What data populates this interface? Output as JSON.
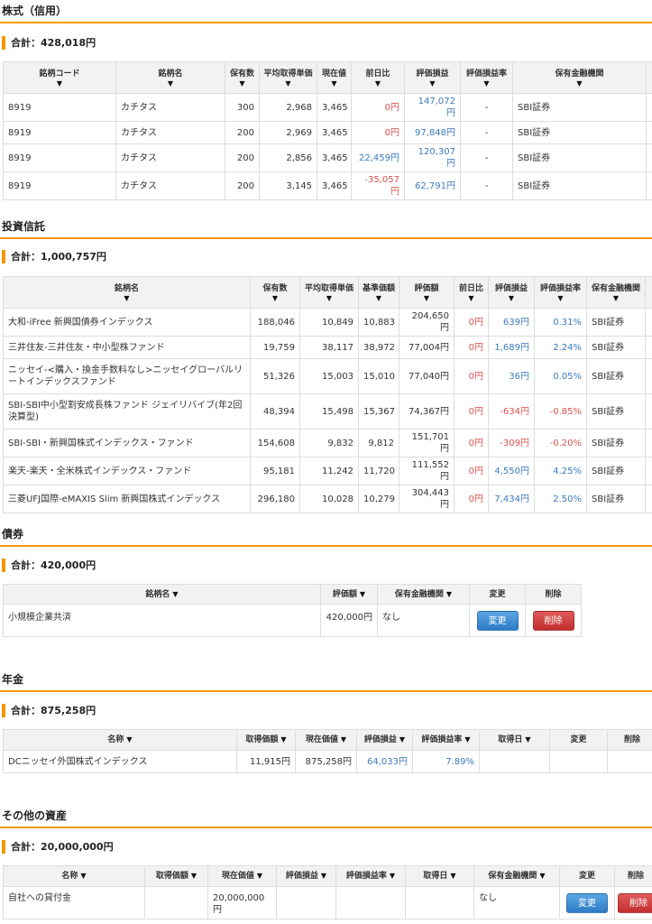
{
  "stocks": {
    "title": "株式（信用）",
    "total": "合計：428,018円",
    "headers": [
      "銘柄コード",
      "銘柄名",
      "保有数",
      "平均取得単価",
      "現在値",
      "前日比",
      "評価損益",
      "評価損益率",
      "保有金融機関"
    ],
    "rows": [
      [
        "8919",
        "カチタス",
        "300",
        "2,968",
        "3,465",
        "0円",
        "147,072円",
        "-",
        "SBI証券"
      ],
      [
        "8919",
        "カチタス",
        "200",
        "2,969",
        "3,465",
        "0円",
        "97,848円",
        "-",
        "SBI証券"
      ],
      [
        "8919",
        "カチタス",
        "200",
        "2,856",
        "3,465",
        "22,459円",
        "120,307円",
        "-",
        "SBI証券"
      ],
      [
        "8919",
        "カチタス",
        "200",
        "3,145",
        "3,465",
        "-35,057円",
        "62,791円",
        "-",
        "SBI証券"
      ]
    ]
  },
  "funds": {
    "title": "投資信託",
    "total": "合計：1,000,757円",
    "headers": [
      "銘柄名",
      "保有数",
      "平均取得単価",
      "基準価額",
      "評価額",
      "前日比",
      "評価損益",
      "評価損益率",
      "保有金融機関"
    ],
    "rows": [
      [
        "大和-iFree 新興国債券インデックス",
        "188,046",
        "10,849",
        "10,883",
        "204,650円",
        "0円",
        "639円",
        "0.31%",
        "SBI証券"
      ],
      [
        "三井住友-三井住友・中小型株ファンド",
        "19,759",
        "38,117",
        "38,972",
        "77,004円",
        "0円",
        "1,689円",
        "2.24%",
        "SBI証券"
      ],
      [
        "ニッセイ-<購入・換金手数料なし>ニッセイグローバルリートインデックスファンド",
        "51,326",
        "15,003",
        "15,010",
        "77,040円",
        "0円",
        "36円",
        "0.05%",
        "SBI証券"
      ],
      [
        "SBI-SBI中小型割安成長株ファンド ジェイリバイブ(年2回決算型)",
        "48,394",
        "15,498",
        "15,367",
        "74,367円",
        "0円",
        "-634円",
        "-0.85%",
        "SBI証券"
      ],
      [
        "SBI-SBI・新興国株式インデックス・ファンド",
        "154,608",
        "9,832",
        "9,812",
        "151,701円",
        "0円",
        "-309円",
        "-0.20%",
        "SBI証券"
      ],
      [
        "楽天-楽天・全米株式インデックス・ファンド",
        "95,181",
        "11,242",
        "11,720",
        "111,552円",
        "0円",
        "4,550円",
        "4.25%",
        "SBI証券"
      ],
      [
        "三菱UFJ国際-eMAXIS Slim 新興国株式インデックス",
        "296,180",
        "10,028",
        "10,279",
        "304,443円",
        "0円",
        "7,434円",
        "2.50%",
        "SBI証券"
      ]
    ]
  },
  "bonds": {
    "title": "債券",
    "total": "合計：420,000円",
    "headers": [
      "銘柄名",
      "評価額",
      "保有金融機関",
      "変更",
      "削除"
    ],
    "rows": [
      {
        "name": "小規模企業共済",
        "value": "420,000円",
        "institution": "なし",
        "edit": "変更",
        "delete": "削除"
      }
    ]
  },
  "pension": {
    "title": "年金",
    "total": "合計：875,258円",
    "headers": [
      "名称",
      "取得価額",
      "現在価値",
      "評価損益",
      "評価損益率",
      "取得日",
      "変更",
      "削除"
    ],
    "rows": [
      [
        "DCニッセイ外国株式インデックス",
        "11,915円",
        "875,258円",
        "64,033円",
        "7.89%",
        "",
        "",
        ""
      ]
    ]
  },
  "other": {
    "title": "その他の資産",
    "total": "合計：20,000,000円",
    "headers": [
      "名称",
      "取得価額",
      "現在価値",
      "評価損益",
      "評価損益率",
      "取得日",
      "保有金融機関",
      "変更",
      "削除"
    ],
    "rows": [
      {
        "name": "自社への貸付金",
        "cost": "",
        "value": "20,000,000円",
        "gain": "",
        "rate": "",
        "date": "",
        "institution": "なし",
        "edit": "変更",
        "delete": "削除"
      }
    ]
  },
  "sort_icon": "triangle-down-icon",
  "colors": {
    "accent": "#f39800",
    "negative": "#d9534f",
    "positive": "#3b7bbf",
    "edit_button": "#2e7bc6",
    "delete_button": "#c22e2e"
  }
}
